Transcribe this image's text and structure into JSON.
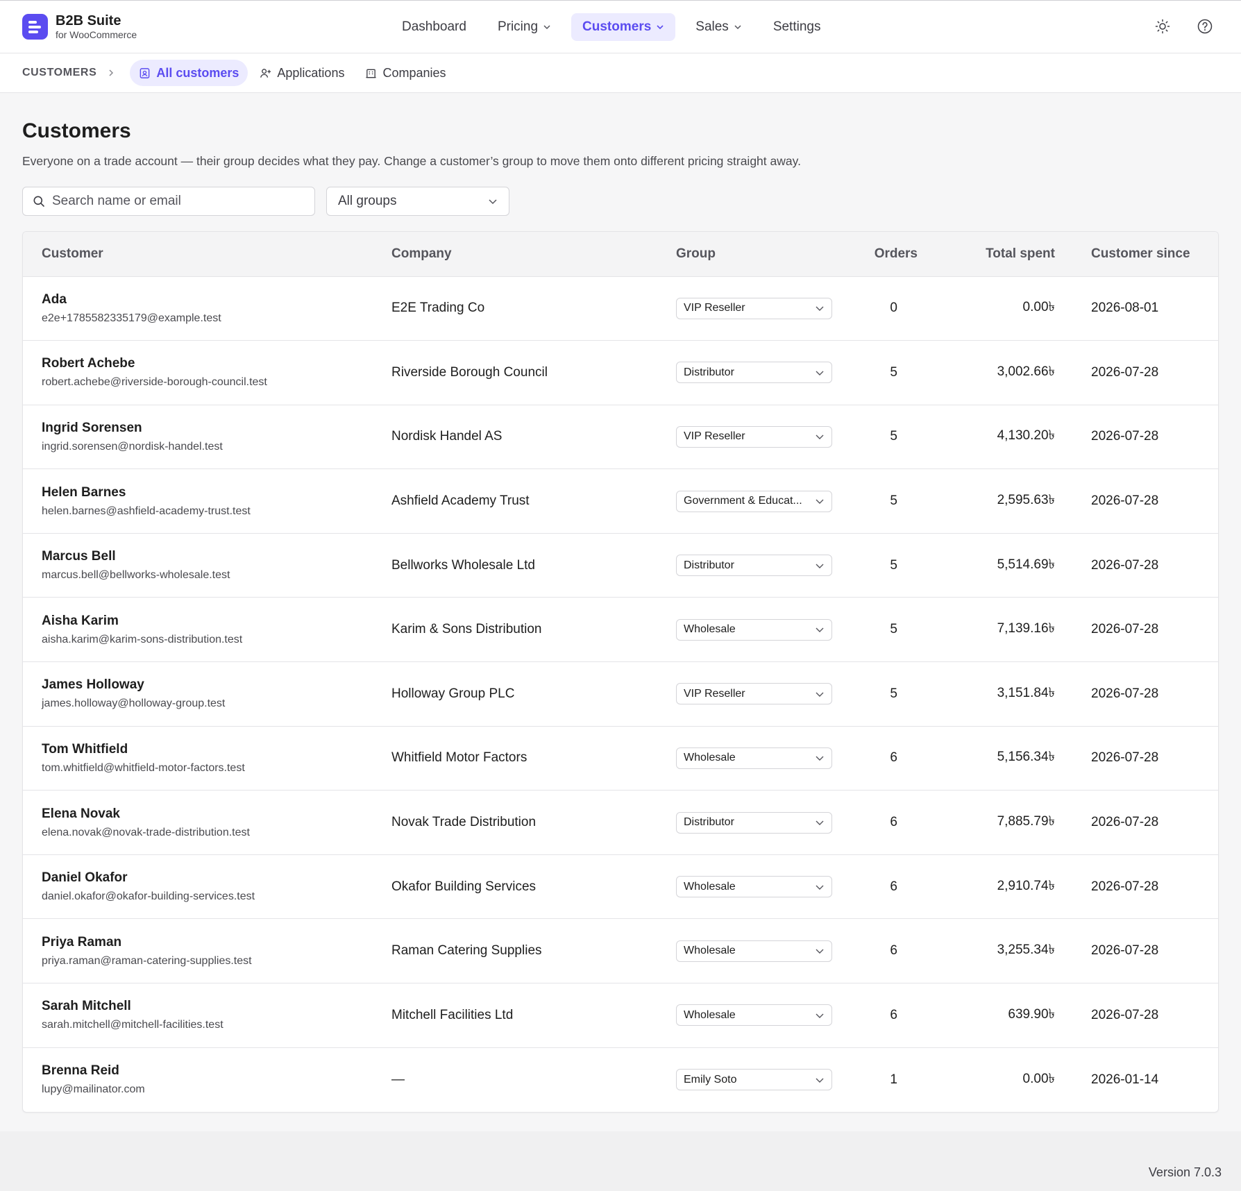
{
  "brand": {
    "name": "B2B Suite",
    "subtitle": "for WooCommerce"
  },
  "nav": {
    "items": [
      {
        "label": "Dashboard",
        "dropdown": false,
        "active": false
      },
      {
        "label": "Pricing",
        "dropdown": true,
        "active": false
      },
      {
        "label": "Customers",
        "dropdown": true,
        "active": true
      },
      {
        "label": "Sales",
        "dropdown": true,
        "active": false
      },
      {
        "label": "Settings",
        "dropdown": false,
        "active": false
      }
    ]
  },
  "subnav": {
    "section": "CUSTOMERS",
    "tabs": [
      {
        "label": "All customers",
        "icon": "contact-card-icon",
        "active": true
      },
      {
        "label": "Applications",
        "icon": "user-plus-icon",
        "active": false
      },
      {
        "label": "Companies",
        "icon": "building-icon",
        "active": false
      }
    ]
  },
  "page": {
    "title": "Customers",
    "description": "Everyone on a trade account — their group decides what they pay. Change a customer’s group to move them onto different pricing straight away."
  },
  "filters": {
    "search_placeholder": "Search name or email",
    "group_filter_value": "All groups"
  },
  "table": {
    "columns": {
      "customer": "Customer",
      "company": "Company",
      "group": "Group",
      "orders": "Orders",
      "total": "Total spent",
      "since": "Customer since"
    },
    "rows": [
      {
        "name": "Ada",
        "email": "e2e+1785582335179@example.test",
        "company": "E2E Trading Co",
        "group": "VIP Reseller",
        "orders": "0",
        "total": "0.00৳",
        "since": "2026-08-01"
      },
      {
        "name": "Robert Achebe",
        "email": "robert.achebe@riverside-borough-council.test",
        "company": "Riverside Borough Council",
        "group": "Distributor",
        "orders": "5",
        "total": "3,002.66৳",
        "since": "2026-07-28"
      },
      {
        "name": "Ingrid Sorensen",
        "email": "ingrid.sorensen@nordisk-handel.test",
        "company": "Nordisk Handel AS",
        "group": "VIP Reseller",
        "orders": "5",
        "total": "4,130.20৳",
        "since": "2026-07-28"
      },
      {
        "name": "Helen Barnes",
        "email": "helen.barnes@ashfield-academy-trust.test",
        "company": "Ashfield Academy Trust",
        "group": "Government & Educat...",
        "orders": "5",
        "total": "2,595.63৳",
        "since": "2026-07-28"
      },
      {
        "name": "Marcus Bell",
        "email": "marcus.bell@bellworks-wholesale.test",
        "company": "Bellworks Wholesale Ltd",
        "group": "Distributor",
        "orders": "5",
        "total": "5,514.69৳",
        "since": "2026-07-28"
      },
      {
        "name": "Aisha Karim",
        "email": "aisha.karim@karim-sons-distribution.test",
        "company": "Karim & Sons Distribution",
        "group": "Wholesale",
        "orders": "5",
        "total": "7,139.16৳",
        "since": "2026-07-28"
      },
      {
        "name": "James Holloway",
        "email": "james.holloway@holloway-group.test",
        "company": "Holloway Group PLC",
        "group": "VIP Reseller",
        "orders": "5",
        "total": "3,151.84৳",
        "since": "2026-07-28"
      },
      {
        "name": "Tom Whitfield",
        "email": "tom.whitfield@whitfield-motor-factors.test",
        "company": "Whitfield Motor Factors",
        "group": "Wholesale",
        "orders": "6",
        "total": "5,156.34৳",
        "since": "2026-07-28"
      },
      {
        "name": "Elena Novak",
        "email": "elena.novak@novak-trade-distribution.test",
        "company": "Novak Trade Distribution",
        "group": "Distributor",
        "orders": "6",
        "total": "7,885.79৳",
        "since": "2026-07-28"
      },
      {
        "name": "Daniel Okafor",
        "email": "daniel.okafor@okafor-building-services.test",
        "company": "Okafor Building Services",
        "group": "Wholesale",
        "orders": "6",
        "total": "2,910.74৳",
        "since": "2026-07-28"
      },
      {
        "name": "Priya Raman",
        "email": "priya.raman@raman-catering-supplies.test",
        "company": "Raman Catering Supplies",
        "group": "Wholesale",
        "orders": "6",
        "total": "3,255.34৳",
        "since": "2026-07-28"
      },
      {
        "name": "Sarah Mitchell",
        "email": "sarah.mitchell@mitchell-facilities.test",
        "company": "Mitchell Facilities Ltd",
        "group": "Wholesale",
        "orders": "6",
        "total": "639.90৳",
        "since": "2026-07-28"
      },
      {
        "name": "Brenna Reid",
        "email": "lupy@mailinator.com",
        "company": "—",
        "group": "Emily Soto",
        "orders": "1",
        "total": "0.00৳",
        "since": "2026-01-14"
      }
    ]
  },
  "footer": {
    "version": "Version 7.0.3"
  },
  "colors": {
    "accent": "#5b4cf0",
    "accent_bg": "#ecebff",
    "page_bg": "#f6f6f7"
  }
}
